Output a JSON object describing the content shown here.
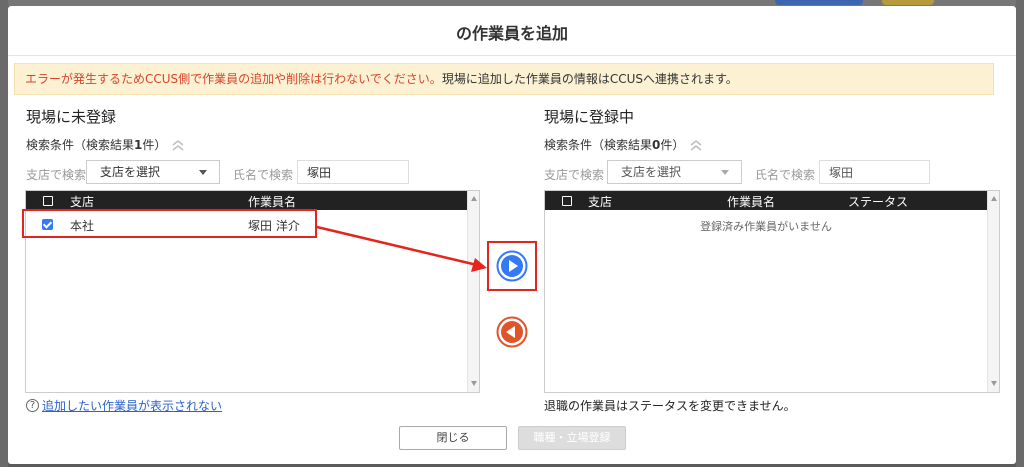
{
  "modal": {
    "title": "の作業員を追加",
    "warning_red": "エラーが発生するためCCUS側で作業員の追加や削除は行わないでください。",
    "warning_normal": "現場に追加した作業員の情報はCCUSへ連携されます。"
  },
  "left_panel": {
    "title": "現場に未登録",
    "condition_prefix": "検索条件（検索結果",
    "result_count": "1",
    "condition_suffix": "件）",
    "branch_label": "支店で検索",
    "branch_select": "支店を選択",
    "name_label": "氏名で検索",
    "name_value": "塚田",
    "columns": [
      "支店",
      "作業員名"
    ],
    "rows": [
      {
        "checked": true,
        "branch": "本社",
        "name": "塚田 洋介"
      }
    ]
  },
  "right_panel": {
    "title": "現場に登録中",
    "condition_prefix": "検索条件（検索結果",
    "result_count": "0",
    "condition_suffix": "件）",
    "branch_label": "支店で検索",
    "branch_select": "支店を選択",
    "name_label": "氏名で検索",
    "name_value": "塚田",
    "columns": [
      "支店",
      "作業員名",
      "ステータス"
    ],
    "empty_message": "登録済み作業員がいません"
  },
  "footer": {
    "help_link": "追加したい作業員が表示されない",
    "note": "退職の作業員はステータスを変更できません。",
    "close_label": "閉じる",
    "register_label": "職種・立場登録"
  },
  "colors": {
    "accent_blue": "#3579f6",
    "accent_orange": "#e0542a",
    "annotation_red": "#e3251e"
  }
}
